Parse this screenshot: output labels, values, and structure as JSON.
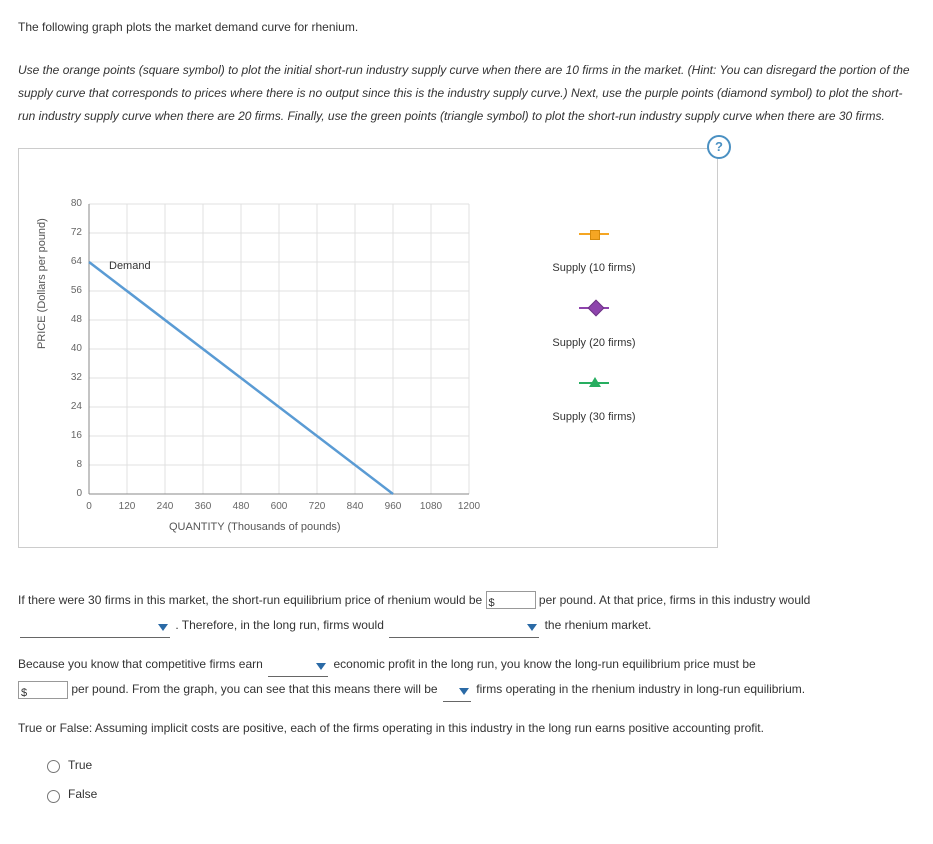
{
  "intro": "The following graph plots the market demand curve for rhenium.",
  "instructions": "Use the orange points (square symbol) to plot the initial short-run industry supply curve when there are 10 firms in the market. (Hint: You can disregard the portion of the supply curve that corresponds to prices where there is no output since this is the industry supply curve.) Next, use the purple points (diamond symbol) to plot the short-run industry supply curve when there are 20 firms. Finally, use the green points (triangle symbol) to plot the short-run industry supply curve when there are 30 firms.",
  "help_icon": "?",
  "chart_data": {
    "type": "line",
    "title": "",
    "xlabel": "QUANTITY (Thousands of pounds)",
    "ylabel": "PRICE (Dollars per pound)",
    "x_ticks": [
      0,
      120,
      240,
      360,
      480,
      600,
      720,
      840,
      960,
      1080,
      1200
    ],
    "y_ticks": [
      0,
      8,
      16,
      24,
      32,
      40,
      48,
      56,
      64,
      72,
      80
    ],
    "xlim": [
      0,
      1200
    ],
    "ylim": [
      0,
      80
    ],
    "series": [
      {
        "name": "Demand",
        "points": [
          [
            0,
            64
          ],
          [
            960,
            0
          ]
        ]
      }
    ],
    "demand_label": "Demand",
    "legend": [
      {
        "symbol": "square-orange",
        "label": "Supply (10 firms)"
      },
      {
        "symbol": "diamond-purple",
        "label": "Supply (20 firms)"
      },
      {
        "symbol": "triangle-green",
        "label": "Supply (30 firms)"
      }
    ]
  },
  "q1": {
    "pre": "If there were 30 firms in this market, the short-run equilibrium price of rhenium would be",
    "dollar_prefix": "$",
    "post1": "per pound. At that price, firms in this industry would",
    "post2": ". Therefore, in the long run, firms would",
    "post3": "the rhenium market."
  },
  "q2": {
    "pre": "Because you know that competitive firms earn",
    "mid1": "economic profit in the long run, you know the long-run equilibrium price must be",
    "dollar_prefix": "$",
    "mid2": "per pound. From the graph, you can see that this means there will be",
    "mid3": "firms operating in the rhenium industry in long-run equilibrium."
  },
  "q3": {
    "prompt": "True or False: Assuming implicit costs are positive, each of the firms operating in this industry in the long run earns positive accounting profit.",
    "opt_true": "True",
    "opt_false": "False"
  }
}
